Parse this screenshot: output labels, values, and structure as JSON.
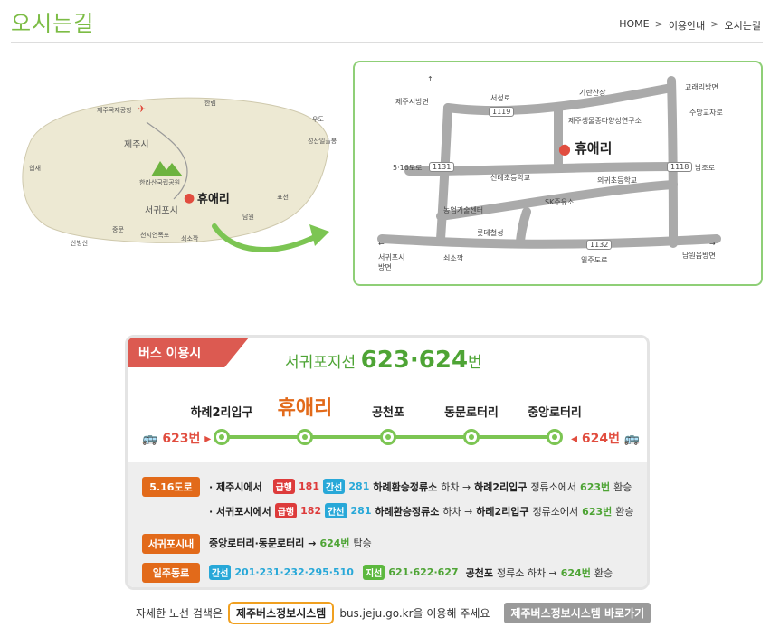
{
  "header": {
    "title": "오시는길",
    "breadcrumb": [
      "HOME",
      "이용안내",
      "오시는길"
    ],
    "breadcrumb_separator": ">"
  },
  "island_map": {
    "labels": {
      "airport": "제주국제공항",
      "hallim": "한림",
      "udo": "우도",
      "jeju_si": "제주시",
      "seongsan": "성산일출봉",
      "hyeopjae": "협재",
      "hallasan": "한라산국립공원",
      "pyoseon": "표선",
      "seogwipo": "서귀포시",
      "namwon": "남원",
      "jungmun": "중문",
      "cheonjiyeon": "천지연폭포",
      "soesokkak": "쇠소깍",
      "sanbangsan": "산방산"
    },
    "logo_text": "휴애리"
  },
  "road_map": {
    "labels": {
      "jeju_dir": "제주시방면",
      "seoseong_ro": "서성로",
      "giran": "기란산장",
      "gyorae_dir": "교래리방면",
      "sumang": "수망교차로",
      "research": "제주생물종다양성연구소",
      "road516": "5·16도로",
      "namjo_ro": "남조로",
      "sillye_school": "신례초등학교",
      "uigwi_school": "의귀초등학교",
      "sk": "SK주유소",
      "tech_center": "농업기술센터",
      "lotte": "롯데철성",
      "seogwipo_dir": "서귀포시\n방면",
      "soesokkak": "쇠소깍",
      "iljudong_ro": "일주도로",
      "namwon_dir": "남원읍방면"
    },
    "road_numbers": [
      "1119",
      "1131",
      "1118",
      "1132"
    ],
    "logo_text": "휴애리"
  },
  "bus": {
    "tab_label": "버스 이용시",
    "heading_prefix": "서귀포지선",
    "heading_numbers": "623·624",
    "heading_suffix": "번",
    "stops": [
      "하례2리입구",
      "휴애리",
      "공천포",
      "동문로터리",
      "중앙로터리"
    ],
    "left_end": "623번",
    "right_end": "624번",
    "rows": [
      {
        "badge": "5.16도로",
        "lines": [
          {
            "from": "· 제주시에서",
            "express_label": "급행",
            "express_no": "181",
            "trunk_label": "간선",
            "trunk_no": "281",
            "transfer_stop": "하례환승정류소",
            "action1": "하차 →",
            "stop": "하례2리입구",
            "action2": "정류소에서",
            "bus": "623번",
            "action3": "환승"
          },
          {
            "from": "· 서귀포시에서",
            "express_label": "급행",
            "express_no": "182",
            "trunk_label": "간선",
            "trunk_no": "281",
            "transfer_stop": "하례환승정류소",
            "action1": "하차 →",
            "stop": "하례2리입구",
            "action2": "정류소에서",
            "bus": "623번",
            "action3": "환승"
          }
        ]
      },
      {
        "badge": "서귀포시내",
        "text_stops": "중앙로터리·동문로터리 →",
        "bus": "624번",
        "action": "탑승"
      },
      {
        "badge": "일주동로",
        "trunk_label": "간선",
        "trunk_nos": "201·231·232·295·510",
        "branch_label": "지선",
        "branch_nos": "621·622·627",
        "stop": "공천포",
        "action1": "정류소 하차 →",
        "bus": "624번",
        "action2": "환승"
      }
    ]
  },
  "footer": {
    "prefix": "자세한 노선 검색은",
    "system_name": "제주버스정보시스템",
    "url_text": "bus.jeju.go.kr을 이용해 주세요",
    "link_button": "제주버스정보시스템 바로가기"
  },
  "colors": {
    "accent_green": "#7cbc45",
    "route_green": "#7cc553",
    "badge_orange": "#e26a1a",
    "tab_red": "#dc5a51",
    "express_red": "#dd3b3b",
    "trunk_blue": "#28a8d8"
  }
}
